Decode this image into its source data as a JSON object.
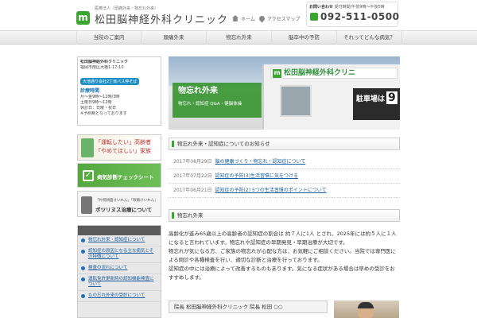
{
  "header": {
    "logo_sub": "医療法人（頭痛外来・物忘れ外来）",
    "logo_title": "松田脳神経外科クリニック",
    "links": [
      {
        "label": "ホーム",
        "icon": "home-icon"
      },
      {
        "label": "アクセスマップ",
        "icon": "map-pin-icon"
      }
    ],
    "phone": {
      "note_label": "お問い合わせ",
      "note_detail": "受付時間/午前9時〜午後5時",
      "number": "092-511-0500"
    }
  },
  "nav": {
    "items": [
      "当院のご案内",
      "頭痛外来",
      "物忘れ外来",
      "脳卒中の予防",
      "それってどんな病気？"
    ]
  },
  "sidebar": {
    "clinic_name": "松田脳神経外科クリニック",
    "address": "福岡市南区大橋1-17-10",
    "bus": "大池通り会社2丁目バス停そば",
    "hours_title": "診療時間",
    "hours_lines": [
      "月〜金9時〜12時/3時",
      "土曜日9時〜12時",
      "休診日：日曜・祝日",
      "※予約制となっております"
    ],
    "banner_license": {
      "line1": "「運転したい」高齢者",
      "line2": "「やめてほしい」家族"
    },
    "banner_checklist": "病気診断チェックシート",
    "banner_botox": {
      "small": "「片側顔面けいれん」「眼瞼けいれん」",
      "main": "ボツリヌス治療について"
    },
    "menu_items": [
      "物忘れ外来・認知症について",
      "認知症の原因となる主な病気とその特徴について",
      "検査の流れについて",
      "運転免許更新時の認知機能検査について",
      "もの忘れ外来の受診について"
    ]
  },
  "hero": {
    "title": "物忘れ外来",
    "subtitle": "物忘れ・認知症 Q&A・健脳体操",
    "sign_text": "松田脳神経外科クリニ",
    "parking_text": "駐車場は",
    "parking_num": "9"
  },
  "news": {
    "heading": "物忘れ外来・認知症についてのお知らせ",
    "items": [
      {
        "date": "2017年08月29日",
        "title": "脳の健康づくり・物忘れ・認知症について"
      },
      {
        "date": "2017年07月22日",
        "title": "認知症の予防(3)生活習慣に気をつける"
      },
      {
        "date": "2017年06月21日",
        "title": "認知症の予防(2) 5つの生活習慣のポイントについて"
      }
    ]
  },
  "intro": {
    "heading": "物忘れ外来",
    "paragraphs": [
      "高齢化が進み65歳以上の高齢者の認知症の割合は 約７人に1人 とされ、2025年には約５人に１人になると言われています。物忘れや認知症の早期発見・早期治療が大切です。",
      "物忘れが気になる方、ご家族の物忘れが心配な方は、お気軽にご相談ください。当院では専門医による問診や各種検査を行い、適切な診断と治療を行っております。",
      "認知症の中には治療によって改善するものもあります。気になる症状がある場合は早めの受診をおすすめします。"
    ]
  },
  "doctor": {
    "heading": "院長 松田脳神経外科クリニック 院長 松田 ○○"
  }
}
